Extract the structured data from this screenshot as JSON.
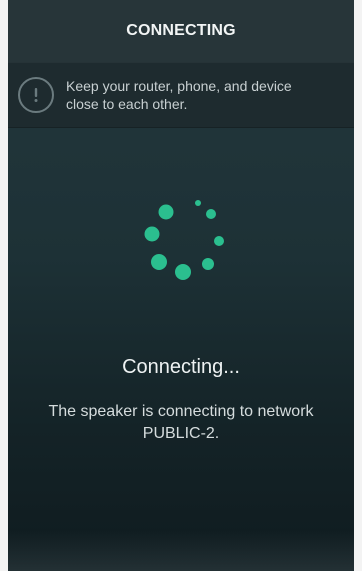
{
  "header": {
    "title": "CONNECTING"
  },
  "notice": {
    "icon": "info-icon",
    "text": "Keep your router, phone, and device close to each other."
  },
  "spinner": {
    "icon": "loading-spinner-icon",
    "color": "#2bbf8f"
  },
  "status": {
    "title": "Connecting...",
    "description": "The speaker is connecting to network PUBLIC-2."
  },
  "colors": {
    "accent": "#2bbf8f",
    "background": "#1d3136"
  }
}
